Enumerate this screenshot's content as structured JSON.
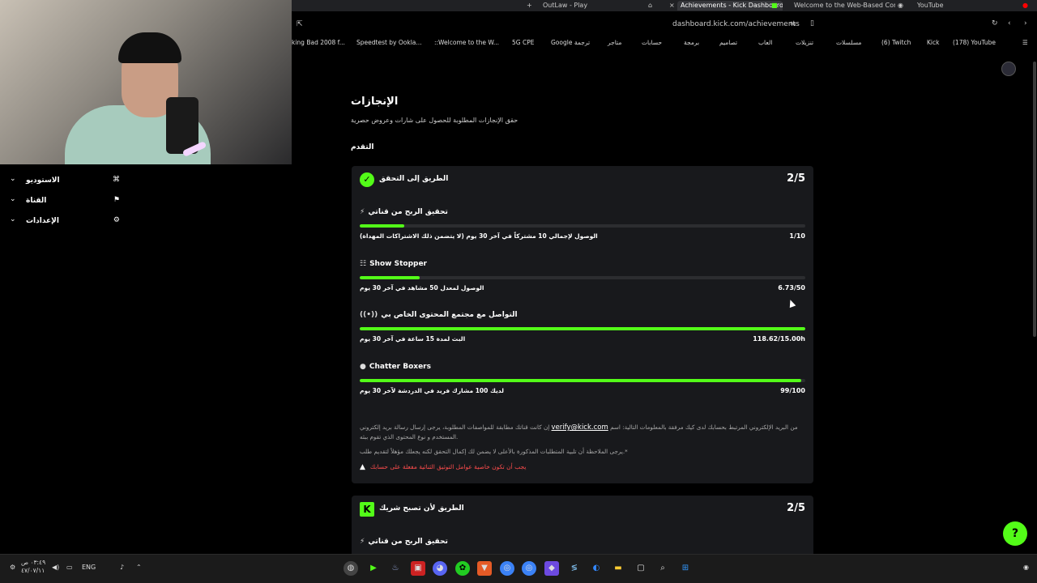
{
  "tabs": [
    {
      "label": "OutLaw - Play"
    },
    {
      "label": "Achievements - Kick Dashboard"
    },
    {
      "label": "Welcome to the Web-Based Config"
    },
    {
      "label": "YouTube"
    }
  ],
  "address": {
    "url": "dashboard.kick.com/achievements"
  },
  "bookmarks": [
    "king Bad 2008 f...",
    "Speedtest by Ookla...",
    "::Welcome to the W...",
    "5G CPE",
    "Google ترجمة",
    "متاجر",
    "حسابات",
    "برمجة",
    "تصاميم",
    "العاب",
    "تنزيلات",
    "مسلسلات",
    "(6) Twitch",
    "Kick",
    "(178) YouTube"
  ],
  "sidebar": {
    "items": [
      {
        "label": "الاستوديو"
      },
      {
        "label": "القناة"
      },
      {
        "label": "الإعدادات"
      }
    ]
  },
  "page": {
    "title": "الإنجازات",
    "subtitle": "حقق الإنجازات المطلوبة للحصول على شارات وعروض حصرية",
    "section": "التقدم"
  },
  "card1": {
    "title": "الطريق إلى التحقق",
    "count": "2/5",
    "achievements": [
      {
        "title": "تحقيق الربح من قناتي",
        "desc": "الوصول لإجمالي 10 مشتركاً في آخر 30 يوم (لا يتضمن ذلك الاشتراكات المهداة)",
        "value": "1/10",
        "progress": 0.1
      },
      {
        "title": "Show Stopper",
        "desc": "الوصول لمعدل 50 مشاهد في آخر 30 يوم",
        "value": "6.73/50",
        "progress": 0.1346
      },
      {
        "title": "التواصل مع مجتمع المحتوى الخاص بي",
        "desc": "البث لمدة 15 ساعة في آخر 30 يوم",
        "value": "118.62/15.00h",
        "progress": 1.0
      },
      {
        "title": "Chatter Boxers",
        "desc": "لديك 100 مشارك فريد في الدردشة لآخر 30 يوم",
        "value": "99/100",
        "progress": 0.99
      }
    ],
    "note1_a": "إن كانت قناتك مطابقة للمواصفات المطلوبة، يرجى إرسال رسالة بريد إلكتروني",
    "note1_link": "verify@kick.com",
    "note1_b": "من البريد الإلكتروني المرتبط بحسابك لدى كيك مرفقة بالمعلومات التالية: اسم",
    "note1_c": "المستخدم و نوع المحتوى الذي تقوم ببثه.",
    "note2": "يرجى الملاحظة أن تلبية المتطلبات المذكورة بالأعلى لا يضمن لك إكمال التحقق لكنه يجعلك مؤهلاً لتقديم طلب.*",
    "warning": "يجب أن تكون خاصية عوامل التوثيق الثنائية مفعلة على حسابك"
  },
  "card2": {
    "title": "الطريق لأن تصبح شريك",
    "count": "2/5",
    "first_item": "تحقيق الربح من قناتي"
  },
  "taskbar": {
    "clock_time": "٠٣:٤٩ ص",
    "clock_date": "٤٧/٠٧/١١",
    "lang": "ENG"
  },
  "colors": {
    "accent": "#53fc18",
    "card_bg": "#18191c",
    "warning": "#ff4d4d"
  }
}
